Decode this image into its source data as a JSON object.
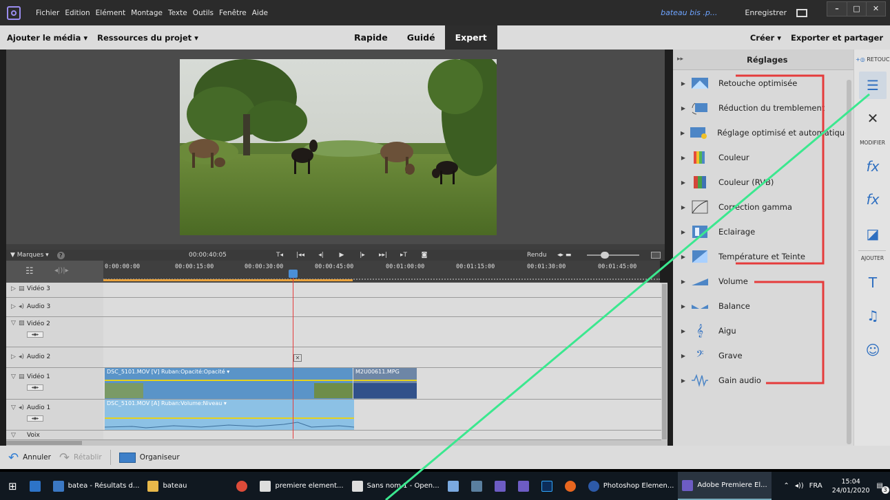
{
  "menubar": {
    "items": [
      "Fichier",
      "Edition",
      "Elément",
      "Montage",
      "Texte",
      "Outils",
      "Fenêtre",
      "Aide"
    ],
    "project_title": "bateau bis .p...",
    "save_label": "Enregistrer"
  },
  "modebar": {
    "add_media": "Ajouter le média ▾",
    "project_assets": "Ressources du projet ▾",
    "modes": [
      "Rapide",
      "Guidé",
      "Expert"
    ],
    "active_mode": "Expert",
    "create": "Créer ▾",
    "export": "Exporter et partager"
  },
  "timeline": {
    "marks": "Marques ▾",
    "help": "?",
    "timecode": "00:00:40:05",
    "render": "Rendu",
    "ruler": [
      "0:00:00:00",
      "00:00:15:00",
      "00:00:30:00",
      "00:00:45:00",
      "00:01:00:00",
      "00:01:15:00",
      "00:01:30:00",
      "00:01:45:00"
    ],
    "tracks": [
      {
        "name": "Vidéo 3"
      },
      {
        "name": "Audio 3"
      },
      {
        "name": "Vidéo 2"
      },
      {
        "name": "Audio 2"
      },
      {
        "name": "Vidéo 1"
      },
      {
        "name": "Audio 1"
      },
      {
        "name": "Voix"
      }
    ],
    "clips": {
      "video1_a": "DSC_5101.MOV [V] Ruban:Opacité:Opacité ▾",
      "video1_b": "M2U00611.MPG",
      "audio1_a": "DSC_5101.MOV [A] Ruban:Volume:Niveau ▾"
    }
  },
  "bottombar": {
    "undo": "Annuler",
    "redo": "Rétablir",
    "organizer": "Organiseur"
  },
  "panel": {
    "title": "Réglages",
    "effects": [
      "Retouche optimisée",
      "Réduction du tremblement",
      "Réglage optimisé et automatique d",
      "Couleur",
      "Couleur (RVB)",
      "Correction gamma",
      "Eclairage",
      "Température et Teinte",
      "Volume",
      "Balance",
      "Aigu",
      "Grave",
      "Gain audio"
    ]
  },
  "toolstrip": {
    "retouche": "RETOUCHE",
    "modifier": "MODIFIER",
    "ajouter": "AJOUTER"
  },
  "taskbar": {
    "items": [
      "batea - Résultats d...",
      "bateau",
      "premiere element...",
      "Sans nom 1 - Open...",
      "Photoshop Elemen...",
      "Adobe Premiere El..."
    ],
    "lang": "FRA",
    "time": "15:04",
    "date": "24/01/2020",
    "notif": "3"
  },
  "colors": {
    "accent_blue": "#2f6fc0",
    "annotation_red": "#e53b3b",
    "annotation_green": "#3be88f",
    "clip_video": "#5a94c8",
    "clip_audio": "#8cc1e5"
  }
}
